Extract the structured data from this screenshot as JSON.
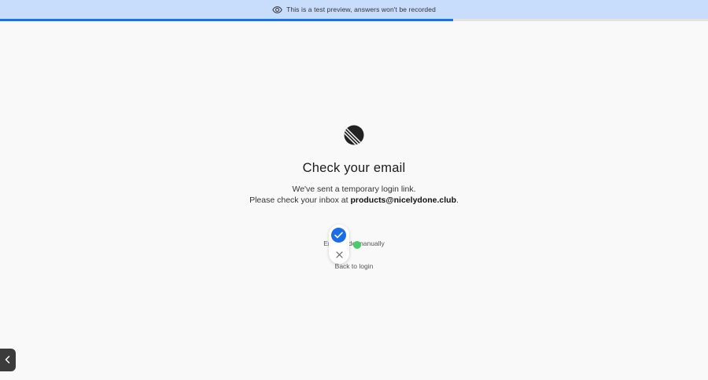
{
  "banner": {
    "icon": "eye-icon",
    "text": "This is a test preview, answers won't be recorded",
    "background": "#c8dcfb"
  },
  "progress": {
    "fraction": 0.64,
    "color": "#1a73e8"
  },
  "logo": {
    "icon": "linear-logo-icon",
    "color": "#222222"
  },
  "main": {
    "title": "Check your email",
    "line1": "We've sent a temporary login link.",
    "line2_prefix": "Please check your inbox at ",
    "email": "products@nicelydone.club",
    "line2_suffix": ".",
    "manual_link": "Enter code manually",
    "back_link": "Back to login"
  },
  "vote_popup": {
    "confirm_icon": "checkmark-icon",
    "dismiss_icon": "close-icon",
    "accent": "#1a6de8"
  },
  "sidebar_toggle": {
    "icon": "chevron-left-icon"
  }
}
